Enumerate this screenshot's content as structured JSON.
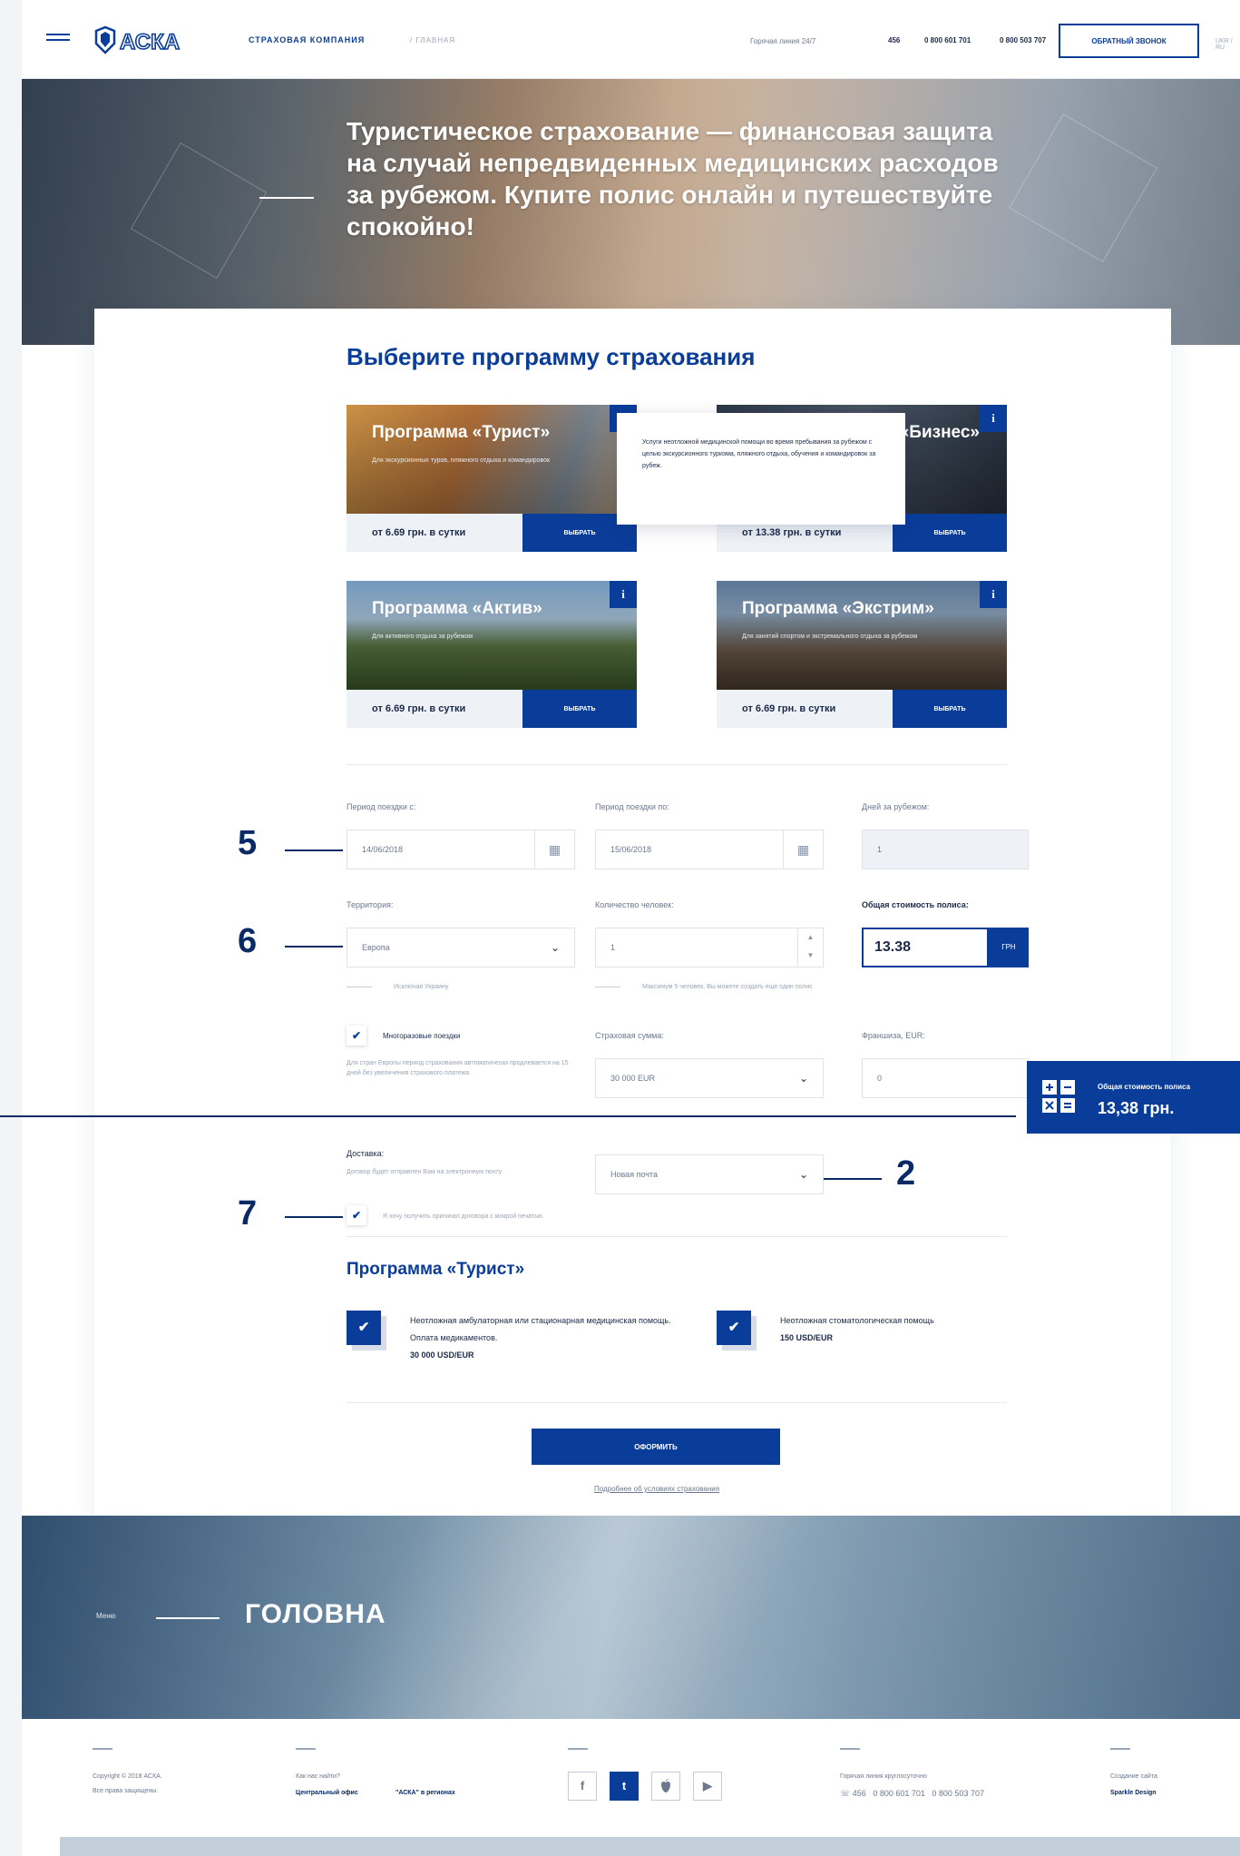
{
  "header": {
    "menu_label": "МЕНЮ",
    "logo_text": "АСКА",
    "company": "СТРАХОВАЯ КОМПАНИЯ",
    "breadcrumb": "/ ГЛАВНАЯ",
    "hotline_label": "Горячая линия 24/7",
    "phones": [
      "456",
      "0 800 601 701",
      "0 800 503 707"
    ],
    "callback_label": "ОБРАТНЫЙ ЗВОНОК",
    "language": "UKR / RU"
  },
  "hero": {
    "text": "Туристическое страхование — финансовая защита на случай непредвиденных медицинских расходов за рубежом. Купите полис онлайн и путешествуйте спокойно!"
  },
  "programs_section": {
    "title": "Выберите программу страхования",
    "choose_label": "ВЫБРАТЬ",
    "info_label": "i",
    "programs": [
      {
        "name": "Программа «Турист»",
        "desc": "Для экскурсионных туров, пляжного отдыха и командировок",
        "price": "от 6.69 грн. в сутки"
      },
      {
        "name": "Программа «Бизнес»",
        "desc": "",
        "price": "от 13.38 грн. в сутки"
      },
      {
        "name": "Программа «Актив»",
        "desc": "Для активного отдыха за рубежом",
        "price": "от 6.69 грн. в сутки"
      },
      {
        "name": "Программа «Экстрим»",
        "desc": "Для занятий спортом и экстремального отдыха за рубежом",
        "price": "от 6.69 грн. в сутки"
      }
    ],
    "tooltip": "Услуги неотложной медицинской помощи во время пребывания за рубежом с целью экскурсионного туризма, пляжного отдыха, обучения и командировок за рубеж."
  },
  "form": {
    "period_from_label": "Период поездки с:",
    "period_from_value": "14/06/2018",
    "period_to_label": "Период поездки по:",
    "period_to_value": "15/06/2018",
    "days_label": "Дней за рубежом:",
    "days_value": "1",
    "territory_label": "Территория:",
    "territory_value": "Европа",
    "territory_hint": "Исключая Украину",
    "people_label": "Количество человек:",
    "people_value": "1",
    "people_hint": "Максимум 5 человек. Вы можете создать еще один полис",
    "total_label": "Общая стоимость полиса:",
    "total_value": "13.38",
    "currency": "ГРН",
    "multi_trip_label": "Многоразовые поездки",
    "multi_trip_hint": "Для стран Европы период страхования автоматически продлевается на 15 дней без увеличения страхового платежа.",
    "sum_label": "Страховая сумма:",
    "sum_value": "30 000 EUR",
    "franchise_label": "Франшиза, EUR:",
    "franchise_value": "0",
    "delivery_label": "Доставка:",
    "delivery_hint": "Договор будет отправлен Вам на электронную почту",
    "delivery_value": "Новая почта",
    "original_label": "Я хочу получить оригинал договора с мокрой печатью",
    "check_mark": "✔"
  },
  "program_details": {
    "title": "Программа «Турист»",
    "features": [
      {
        "text": "Неотложная амбулаторная или стационарная медицинская помощь. Оплата медикаментов.",
        "amount": "30 000 USD/EUR"
      },
      {
        "text": "Неотложная стоматологическая помощь",
        "amount": "150 USD/EUR"
      }
    ]
  },
  "actions": {
    "order_label": "ОФОРМИТЬ",
    "terms_label": "Подробнее об условиях страхования"
  },
  "floating_total": {
    "label": "Общая стоимость полиса",
    "value": "13,38 грн."
  },
  "annotations": [
    "5",
    "6",
    "2",
    "7"
  ],
  "bottom_hero": {
    "menu_label": "Меню",
    "title": "ГОЛОВНА"
  },
  "footer": {
    "copyright": "Copyright © 2018 АСКА.",
    "rights": "Все права защищены.",
    "how_to_find": "Как нас найти?",
    "central_office": "Центральный офис",
    "regions": "\"АСКА\" в регионах",
    "social": [
      "f",
      "t",
      "",
      "▶"
    ],
    "hotline_label": "Горячая линия круглосуточно",
    "phones": [
      "456",
      "0 800 601 701",
      "0 800 503 707"
    ],
    "created_label": "Создание сайта",
    "creator": "Sparkle Design"
  },
  "colors": {
    "brand": "#0a3d99",
    "annotation": "#0a2a66"
  }
}
